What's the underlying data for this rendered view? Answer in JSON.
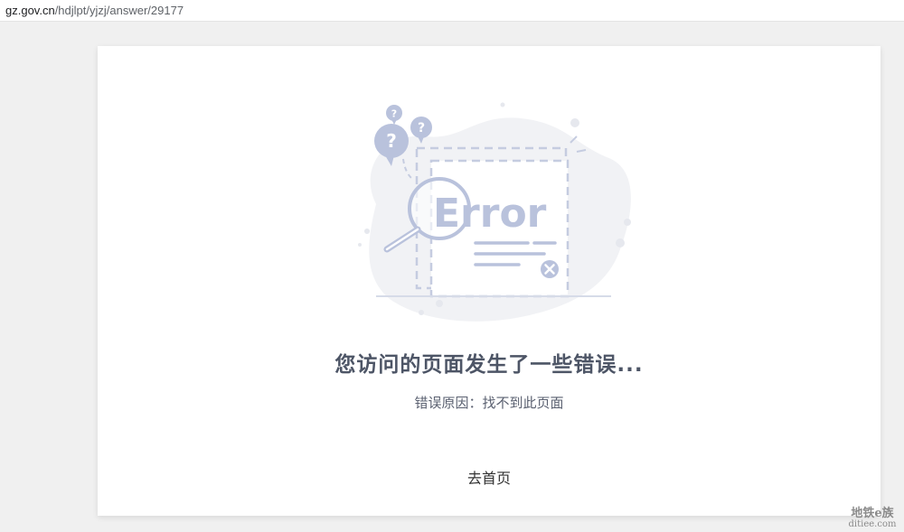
{
  "browser": {
    "url_host": "gz.gov.cn",
    "url_path": "/hdjlpt/yjzj/answer/29177"
  },
  "error_page": {
    "illustration_word": "Error",
    "title": "您访问的页面发生了一些错误...",
    "reason": "错误原因：找不到此页面",
    "home_link": "去首页",
    "accent_color": "#b9c2dc",
    "blob_color": "#f1f2f5"
  },
  "watermark": {
    "line1": "地铁e族",
    "line2": "ditiee.com"
  }
}
